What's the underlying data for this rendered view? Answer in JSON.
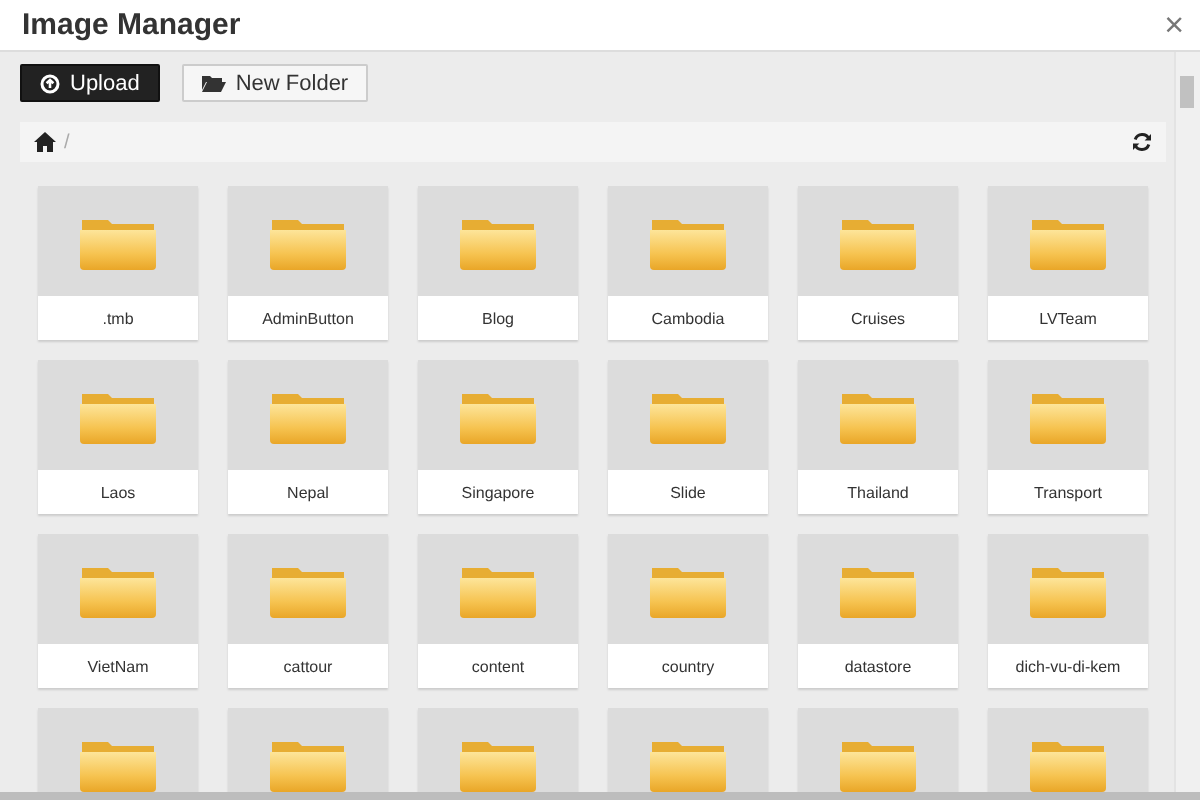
{
  "window": {
    "title": "Image Manager",
    "close": "×"
  },
  "toolbar": {
    "buttons": [
      {
        "label": "Upload",
        "kind": "primary"
      },
      {
        "label": "New Folder",
        "kind": "default"
      }
    ]
  },
  "breadcrumb": {
    "separator": "/"
  },
  "folders": [
    {
      "kind": "folder",
      "name": ".tmb"
    },
    {
      "kind": "folder",
      "name": "AdminButton"
    },
    {
      "kind": "folder",
      "name": "Blog"
    },
    {
      "kind": "folder",
      "name": "Cambodia"
    },
    {
      "kind": "folder",
      "name": "Cruises"
    },
    {
      "kind": "folder",
      "name": "LVTeam"
    },
    {
      "kind": "folder",
      "name": "Laos"
    },
    {
      "kind": "folder",
      "name": "Nepal"
    },
    {
      "kind": "folder",
      "name": "Singapore"
    },
    {
      "kind": "folder",
      "name": "Slide"
    },
    {
      "kind": "folder",
      "name": "Thailand"
    },
    {
      "kind": "folder",
      "name": "Transport"
    },
    {
      "kind": "folder",
      "name": "VietNam"
    },
    {
      "kind": "folder",
      "name": "cattour"
    },
    {
      "kind": "folder",
      "name": "content"
    },
    {
      "kind": "folder",
      "name": "country"
    },
    {
      "kind": "folder",
      "name": "datastore"
    },
    {
      "kind": "folder",
      "name": "dich-vu-di-kem"
    },
    {
      "kind": "cut-off"
    },
    {
      "kind": "cut-off"
    },
    {
      "kind": "cut-off"
    },
    {
      "kind": "cut-off"
    },
    {
      "kind": "cut-off"
    },
    {
      "kind": "cut-off"
    }
  ]
}
